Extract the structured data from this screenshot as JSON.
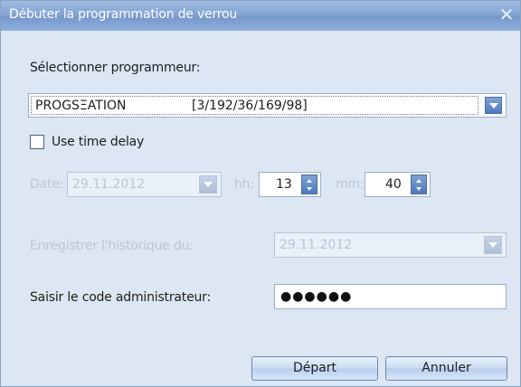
{
  "window": {
    "title": "Débuter la programmation de verrou"
  },
  "programmer": {
    "label": "Sélectionner programmeur:",
    "selected_name": "PROGSΞATION",
    "selected_address": "[3/192/36/169/98]"
  },
  "delay": {
    "checkbox_label": "Use time delay",
    "checked": false,
    "date_label": "Date:",
    "date_value": "29.11.2012",
    "hh_label": "hh:",
    "hh_value": "13",
    "mm_label": "mm:",
    "mm_value": "40"
  },
  "history": {
    "label": "Enregistrer l'historique du:",
    "date_value": "29.11.2012"
  },
  "admin": {
    "label": "Saisir le code administrateur:",
    "masked_value": "●●●●●●"
  },
  "buttons": {
    "start": "Départ",
    "cancel": "Annuler"
  }
}
